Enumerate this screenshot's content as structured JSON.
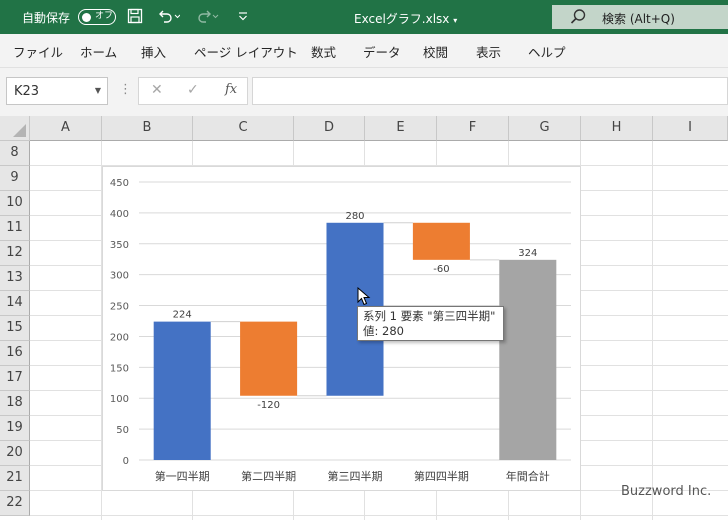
{
  "titlebar": {
    "autosave_label": "自動保存",
    "autosave_state": "オフ",
    "file_title": "Excelグラフ.xlsx",
    "search_placeholder": "検索 (Alt+Q)",
    "icons": [
      "save-icon",
      "undo-icon",
      "redo-icon",
      "customize-qat-icon",
      "search-icon"
    ],
    "brand_color": "#217346"
  },
  "ribbon": {
    "tabs": [
      "ファイル",
      "ホーム",
      "挿入",
      "ページ レイアウト",
      "数式",
      "データ",
      "校閲",
      "表示",
      "ヘルプ"
    ]
  },
  "formula_bar": {
    "name_box": "K23",
    "formula": ""
  },
  "grid": {
    "columns": [
      "A",
      "B",
      "C",
      "D",
      "E",
      "F",
      "G",
      "H",
      "I"
    ],
    "rows": [
      "8",
      "9",
      "10",
      "11",
      "12",
      "13",
      "14",
      "15",
      "16",
      "17",
      "18",
      "19",
      "20",
      "21",
      "22"
    ]
  },
  "chart_data": {
    "type": "bar",
    "subtype": "waterfall",
    "categories": [
      "第一四半期",
      "第二四半期",
      "第三四半期",
      "第四四半期",
      "年間合計"
    ],
    "series": [
      {
        "name": "系列 1",
        "values": [
          224,
          -120,
          280,
          -60,
          324
        ]
      }
    ],
    "bars": [
      {
        "category": "第一四半期",
        "start": 0,
        "end": 224,
        "label": "224",
        "color": "#4472c4"
      },
      {
        "category": "第二四半期",
        "start": 224,
        "end": 104,
        "label": "-120",
        "color": "#ed7d31"
      },
      {
        "category": "第三四半期",
        "start": 104,
        "end": 384,
        "label": "280",
        "color": "#4472c4"
      },
      {
        "category": "第四四半期",
        "start": 384,
        "end": 324,
        "label": "-60",
        "color": "#ed7d31"
      },
      {
        "category": "年間合計",
        "start": 0,
        "end": 324,
        "label": "324",
        "color": "#a5a5a5"
      }
    ],
    "y_ticks": [
      "0",
      "50",
      "100",
      "150",
      "200",
      "250",
      "300",
      "350",
      "400",
      "450"
    ],
    "ylim": [
      0,
      450
    ],
    "grid": true,
    "legend": "none"
  },
  "tooltip": {
    "line1": "系列 1 要素 \"第三四半期\"",
    "line2": "値: 280"
  },
  "watermark": "Buzzword Inc."
}
